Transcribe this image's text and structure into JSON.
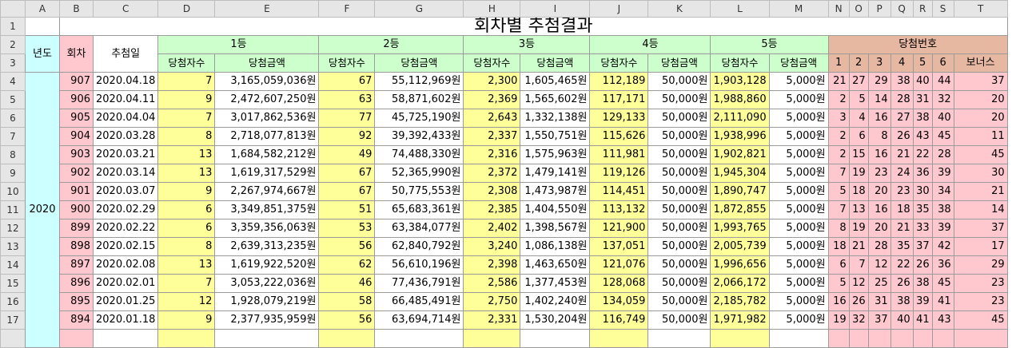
{
  "columns": [
    "A",
    "B",
    "C",
    "D",
    "E",
    "F",
    "G",
    "H",
    "I",
    "J",
    "K",
    "L",
    "M",
    "N",
    "O",
    "P",
    "Q",
    "R",
    "S",
    "T"
  ],
  "title": "회차별 추첨결과",
  "headers": {
    "year": "년도",
    "round": "회차",
    "date": "추첨일",
    "prize1": "1등",
    "prize2": "2등",
    "prize3": "3등",
    "prize4": "4등",
    "prize5": "5등",
    "numbers": "당첨번호",
    "winners": "당첨자수",
    "amount": "당첨금액",
    "n1": "1",
    "n2": "2",
    "n3": "3",
    "n4": "4",
    "n5": "5",
    "n6": "6",
    "bonus": "보너스"
  },
  "year_value": "2020",
  "rows": [
    {
      "row": "4",
      "round": "907",
      "date": "2020.04.18",
      "w1": "7",
      "a1": "3,165,059,036원",
      "w2": "67",
      "a2": "55,112,969원",
      "w3": "2,300",
      "a3": "1,605,465원",
      "w4": "112,189",
      "a4": "50,000원",
      "w5": "1,903,128",
      "a5": "5,000원",
      "n": [
        "21",
        "27",
        "29",
        "38",
        "40",
        "44"
      ],
      "bonus": "37"
    },
    {
      "row": "5",
      "round": "906",
      "date": "2020.04.11",
      "w1": "9",
      "a1": "2,472,607,250원",
      "w2": "63",
      "a2": "58,871,602원",
      "w3": "2,369",
      "a3": "1,565,602원",
      "w4": "117,171",
      "a4": "50,000원",
      "w5": "1,988,860",
      "a5": "5,000원",
      "n": [
        "2",
        "5",
        "14",
        "28",
        "31",
        "32"
      ],
      "bonus": "20"
    },
    {
      "row": "6",
      "round": "905",
      "date": "2020.04.04",
      "w1": "7",
      "a1": "3,017,862,536원",
      "w2": "77",
      "a2": "45,725,190원",
      "w3": "2,643",
      "a3": "1,332,138원",
      "w4": "129,133",
      "a4": "50,000원",
      "w5": "2,111,090",
      "a5": "5,000원",
      "n": [
        "3",
        "4",
        "16",
        "27",
        "38",
        "40"
      ],
      "bonus": "20"
    },
    {
      "row": "7",
      "round": "904",
      "date": "2020.03.28",
      "w1": "8",
      "a1": "2,718,077,813원",
      "w2": "92",
      "a2": "39,392,433원",
      "w3": "2,337",
      "a3": "1,550,751원",
      "w4": "115,626",
      "a4": "50,000원",
      "w5": "1,938,996",
      "a5": "5,000원",
      "n": [
        "2",
        "6",
        "8",
        "26",
        "43",
        "45"
      ],
      "bonus": "11"
    },
    {
      "row": "8",
      "round": "903",
      "date": "2020.03.21",
      "w1": "13",
      "a1": "1,684,582,212원",
      "w2": "49",
      "a2": "74,488,330원",
      "w3": "2,316",
      "a3": "1,575,963원",
      "w4": "111,981",
      "a4": "50,000원",
      "w5": "1,902,821",
      "a5": "5,000원",
      "n": [
        "2",
        "15",
        "16",
        "21",
        "22",
        "28"
      ],
      "bonus": "45"
    },
    {
      "row": "9",
      "round": "902",
      "date": "2020.03.14",
      "w1": "13",
      "a1": "1,619,317,529원",
      "w2": "67",
      "a2": "52,365,990원",
      "w3": "2,372",
      "a3": "1,479,141원",
      "w4": "119,126",
      "a4": "50,000원",
      "w5": "1,945,304",
      "a5": "5,000원",
      "n": [
        "7",
        "19",
        "23",
        "24",
        "36",
        "39"
      ],
      "bonus": "30"
    },
    {
      "row": "10",
      "round": "901",
      "date": "2020.03.07",
      "w1": "9",
      "a1": "2,267,974,667원",
      "w2": "67",
      "a2": "50,775,553원",
      "w3": "2,308",
      "a3": "1,473,987원",
      "w4": "114,451",
      "a4": "50,000원",
      "w5": "1,890,747",
      "a5": "5,000원",
      "n": [
        "5",
        "18",
        "20",
        "23",
        "30",
        "34"
      ],
      "bonus": "21"
    },
    {
      "row": "11",
      "round": "900",
      "date": "2020.02.29",
      "w1": "6",
      "a1": "3,349,851,375원",
      "w2": "51",
      "a2": "65,683,361원",
      "w3": "2,385",
      "a3": "1,404,550원",
      "w4": "113,132",
      "a4": "50,000원",
      "w5": "1,872,855",
      "a5": "5,000원",
      "n": [
        "7",
        "13",
        "16",
        "18",
        "35",
        "38"
      ],
      "bonus": "14"
    },
    {
      "row": "12",
      "round": "899",
      "date": "2020.02.22",
      "w1": "6",
      "a1": "3,359,356,063원",
      "w2": "53",
      "a2": "63,384,077원",
      "w3": "2,402",
      "a3": "1,398,567원",
      "w4": "121,900",
      "a4": "50,000원",
      "w5": "1,993,765",
      "a5": "5,000원",
      "n": [
        "8",
        "19",
        "20",
        "21",
        "33",
        "39"
      ],
      "bonus": "37"
    },
    {
      "row": "13",
      "round": "898",
      "date": "2020.02.15",
      "w1": "8",
      "a1": "2,639,313,235원",
      "w2": "56",
      "a2": "62,840,792원",
      "w3": "3,240",
      "a3": "1,086,138원",
      "w4": "137,051",
      "a4": "50,000원",
      "w5": "2,005,739",
      "a5": "5,000원",
      "n": [
        "18",
        "21",
        "28",
        "35",
        "37",
        "42"
      ],
      "bonus": "17"
    },
    {
      "row": "14",
      "round": "897",
      "date": "2020.02.08",
      "w1": "13",
      "a1": "1,619,922,520원",
      "w2": "62",
      "a2": "56,610,196원",
      "w3": "2,398",
      "a3": "1,463,650원",
      "w4": "121,076",
      "a4": "50,000원",
      "w5": "1,996,656",
      "a5": "5,000원",
      "n": [
        "6",
        "7",
        "12",
        "22",
        "26",
        "36"
      ],
      "bonus": "29"
    },
    {
      "row": "15",
      "round": "896",
      "date": "2020.02.01",
      "w1": "7",
      "a1": "3,053,222,036원",
      "w2": "46",
      "a2": "77,436,791원",
      "w3": "2,586",
      "a3": "1,377,453원",
      "w4": "128,068",
      "a4": "50,000원",
      "w5": "2,066,172",
      "a5": "5,000원",
      "n": [
        "5",
        "12",
        "25",
        "26",
        "38",
        "45"
      ],
      "bonus": "23"
    },
    {
      "row": "16",
      "round": "895",
      "date": "2020.01.25",
      "w1": "12",
      "a1": "1,928,079,219원",
      "w2": "58",
      "a2": "66,485,491원",
      "w3": "2,750",
      "a3": "1,402,240원",
      "w4": "134,059",
      "a4": "50,000원",
      "w5": "2,185,782",
      "a5": "5,000원",
      "n": [
        "16",
        "26",
        "31",
        "38",
        "39",
        "41"
      ],
      "bonus": "23"
    },
    {
      "row": "17",
      "round": "894",
      "date": "2020.01.18",
      "w1": "9",
      "a1": "2,377,935,959원",
      "w2": "56",
      "a2": "63,694,714원",
      "w3": "2,331",
      "a3": "1,530,204원",
      "w4": "116,749",
      "a4": "50,000원",
      "w5": "1,971,982",
      "a5": "5,000원",
      "n": [
        "19",
        "32",
        "37",
        "40",
        "41",
        "43"
      ],
      "bonus": "45"
    }
  ]
}
